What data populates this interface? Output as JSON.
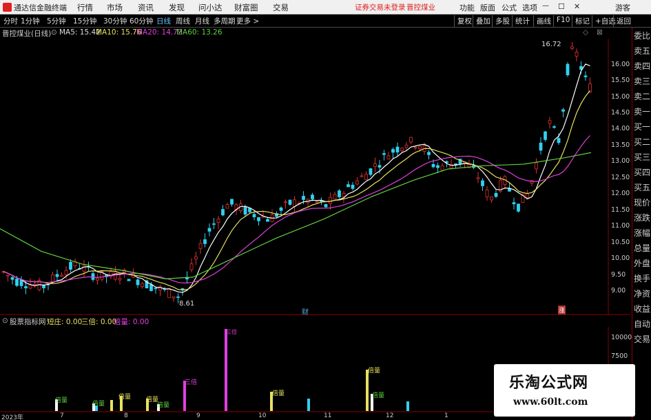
{
  "window": {
    "title": "通达信金融终端",
    "menus": [
      "行情",
      "市场",
      "资讯",
      "发现",
      "问小达",
      "财富圈",
      "交易"
    ],
    "notice": "证券交易未登录",
    "stock_notice": "晋控煤业",
    "buttons": [
      "功能",
      "版面",
      "公式",
      "选项"
    ],
    "guest": "游客"
  },
  "toolbar": {
    "periods": [
      "分时",
      "1分钟",
      "5分钟",
      "15分钟",
      "30分钟",
      "60分钟",
      "日线",
      "周线",
      "月线",
      "多周期",
      "更多 >"
    ],
    "active": "日线",
    "right": [
      "复权",
      "叠加",
      "多股",
      "统计",
      "画线",
      "F10",
      "标记",
      "+自选",
      "返回"
    ]
  },
  "info": {
    "name": "晋控煤业(日线)",
    "ma5": "MA5: 15.42",
    "ma10": "MA10: 15.76",
    "ma20": "MA20: 14.72",
    "ma60": "MA60: 13.26"
  },
  "colors": {
    "up": "#e03030",
    "down": "#30d0f0",
    "ma5": "#ffffff",
    "ma10": "#e8e060",
    "ma20": "#e040e0",
    "ma60": "#60d040"
  },
  "right_panel": [
    "委比",
    "卖五",
    "卖四",
    "卖三",
    "卖二",
    "卖一",
    "买一",
    "买二",
    "买三",
    "买四",
    "买五",
    "现价",
    "涨跌",
    "涨幅",
    "总量",
    "外盘",
    "换手",
    "净资",
    "收益",
    "自动",
    "交易"
  ],
  "price_axis": [
    "16.00",
    "15.50",
    "15.00",
    "14.50",
    "14.00",
    "13.50",
    "13.00",
    "12.50",
    "12.00",
    "11.50",
    "11.00",
    "10.50",
    "10.00",
    "9.50",
    "9.00"
  ],
  "annotations": {
    "high": "16.72",
    "low": "8.61",
    "marker1": "财",
    "marker2": "涨"
  },
  "sub": {
    "title": "股票指标网",
    "v1": "短庄: 0.00",
    "v2": "三倍: 0.00",
    "v3": "倍量: 0.00",
    "axis": [
      "10000",
      "7500"
    ],
    "labels": [
      "倍量",
      "倍量",
      "倍量",
      "倍量",
      "倍量",
      "三倍",
      "三倍",
      "倍量",
      "倍量",
      "倍量"
    ]
  },
  "date_axis": [
    "2023年",
    "7",
    "8",
    "9",
    "10",
    "11",
    "12",
    "1"
  ],
  "watermark": {
    "title": "乐淘公式网",
    "url": "www.60lt.com"
  }
}
